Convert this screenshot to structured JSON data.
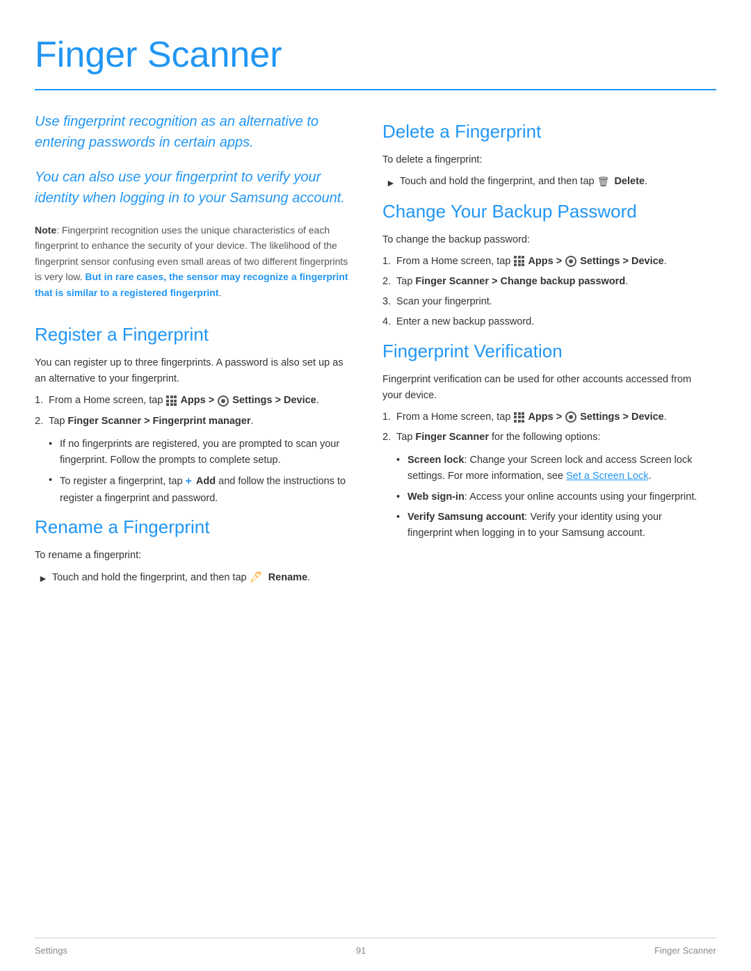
{
  "page": {
    "title": "Finger Scanner",
    "intro1": "Use fingerprint recognition as an alternative to entering passwords in certain apps.",
    "intro2": "You can also use your fingerprint to verify your identity when logging in to your Samsung account.",
    "note_label": "Note",
    "note_text": ": Fingerprint recognition uses the unique characteristics of each fingerprint to enhance the security of your device. The likelihood of the fingerprint sensor confusing even small areas of two different fingerprints is very low.",
    "note_bold_blue": "But in rare cases, the sensor may recognize a fingerprint that is similar to a registered fingerprint",
    "note_end": "."
  },
  "sections": {
    "register": {
      "title": "Register a Fingerprint",
      "intro": "You can register up to three fingerprints. A password is also set up as an alternative to your fingerprint.",
      "steps": [
        {
          "num": "1.",
          "text": "From a Home screen, tap",
          "apps_icon": true,
          "apps_label": "Apps >",
          "settings_icon": true,
          "settings_label": "Settings > Device."
        },
        {
          "num": "2.",
          "text_bold": "Tap Finger Scanner > Fingerprint manager.",
          "text": ""
        }
      ],
      "bullets": [
        "If no fingerprints are registered, you are prompted to scan your fingerprint. Follow the prompts to complete setup.",
        "To register a fingerprint, tap"
      ],
      "bullet2_addon": "Add and follow the instructions to register a fingerprint and password.",
      "bullet2_has_plus": true
    },
    "rename": {
      "title": "Rename a Fingerprint",
      "intro": "To rename a fingerprint:",
      "arrow_text": "Touch and hold the fingerprint, and then tap",
      "arrow_icon_label": "🖊",
      "rename_label": "Rename."
    },
    "delete": {
      "title": "Delete a Fingerprint",
      "intro": "To delete a fingerprint:",
      "arrow_text": "Touch and hold the fingerprint, and then tap",
      "delete_label": "Delete."
    },
    "change_backup": {
      "title": "Change Your Backup Password",
      "intro": "To change the backup password:",
      "steps": [
        {
          "num": "1.",
          "text": "From a Home screen, tap",
          "apps_icon": true,
          "apps_label": "Apps >",
          "settings_icon": true,
          "settings_label": "Settings > Device."
        },
        {
          "num": "2.",
          "text": "Tap",
          "bold_part": "Finger Scanner > Change backup password."
        },
        {
          "num": "3.",
          "text": "Scan your fingerprint."
        },
        {
          "num": "4.",
          "text": "Enter a new backup password."
        }
      ]
    },
    "verification": {
      "title": "Fingerprint Verification",
      "intro": "Fingerprint verification can be used for other accounts accessed from your device.",
      "steps": [
        {
          "num": "1.",
          "text": "From a Home screen, tap",
          "apps_icon": true,
          "apps_label": "Apps >",
          "settings_icon": true,
          "settings_label": "Settings > Device."
        },
        {
          "num": "2.",
          "text": "Tap",
          "bold_part": "Finger Scanner",
          "rest": "for the following options:"
        }
      ],
      "bullets": [
        {
          "bold": "Screen lock",
          "text": ": Change your Screen lock and access Screen lock settings. For more information, see",
          "link": "Set a Screen Lock",
          "text2": "."
        },
        {
          "bold": "Web sign-in",
          "text": ": Access your online accounts using your fingerprint.",
          "link": "",
          "text2": ""
        },
        {
          "bold": "Verify Samsung account",
          "text": ": Verify your identity using your fingerprint when logging in to your Samsung account.",
          "link": "",
          "text2": ""
        }
      ]
    }
  },
  "footer": {
    "left": "Settings",
    "center": "91",
    "right": "Finger Scanner"
  }
}
